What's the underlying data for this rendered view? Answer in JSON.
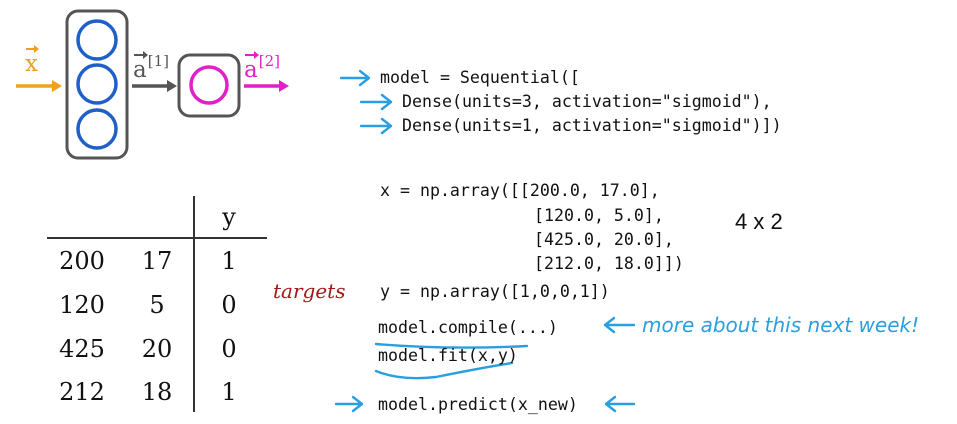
{
  "network": {
    "input_label": {
      "base": "x"
    },
    "hidden_label": {
      "base": "a",
      "sup": "[1]"
    },
    "output_label": {
      "base": "a",
      "sup": "[2]"
    },
    "hidden_units": 3,
    "output_units": 1,
    "colors": {
      "input": "#f0a020",
      "layer_box": "#555555",
      "hidden_unit": "#1f5fc8",
      "output_unit": "#e020c8",
      "arrow": "#555555",
      "hand_blue": "#2a9fe0",
      "hand_red": "#a01818"
    }
  },
  "code": {
    "model_lines": [
      "model = Sequential([",
      "Dense(units=3, activation=\"sigmoid\"),",
      "Dense(units=1, activation=\"sigmoid\")])"
    ],
    "x_lines": [
      "x = np.array([[200.0, 17.0],",
      "[120.0, 5.0],",
      "[425.0, 20.0],",
      "[212.0, 18.0]])"
    ],
    "y_line": "y = np.array([1,0,0,1])",
    "compile_line": "model.compile(...)",
    "fit_line": "model.fit(x,y)",
    "predict_line": "model.predict(x_new)"
  },
  "annotations": {
    "shape": "4 x 2",
    "targets": "targets",
    "next_week": "more about this next week!"
  },
  "table": {
    "header_y": "y",
    "rows": [
      [
        "200",
        "17",
        "1"
      ],
      [
        "120",
        "5",
        "0"
      ],
      [
        "425",
        "20",
        "0"
      ],
      [
        "212",
        "18",
        "1"
      ]
    ]
  }
}
